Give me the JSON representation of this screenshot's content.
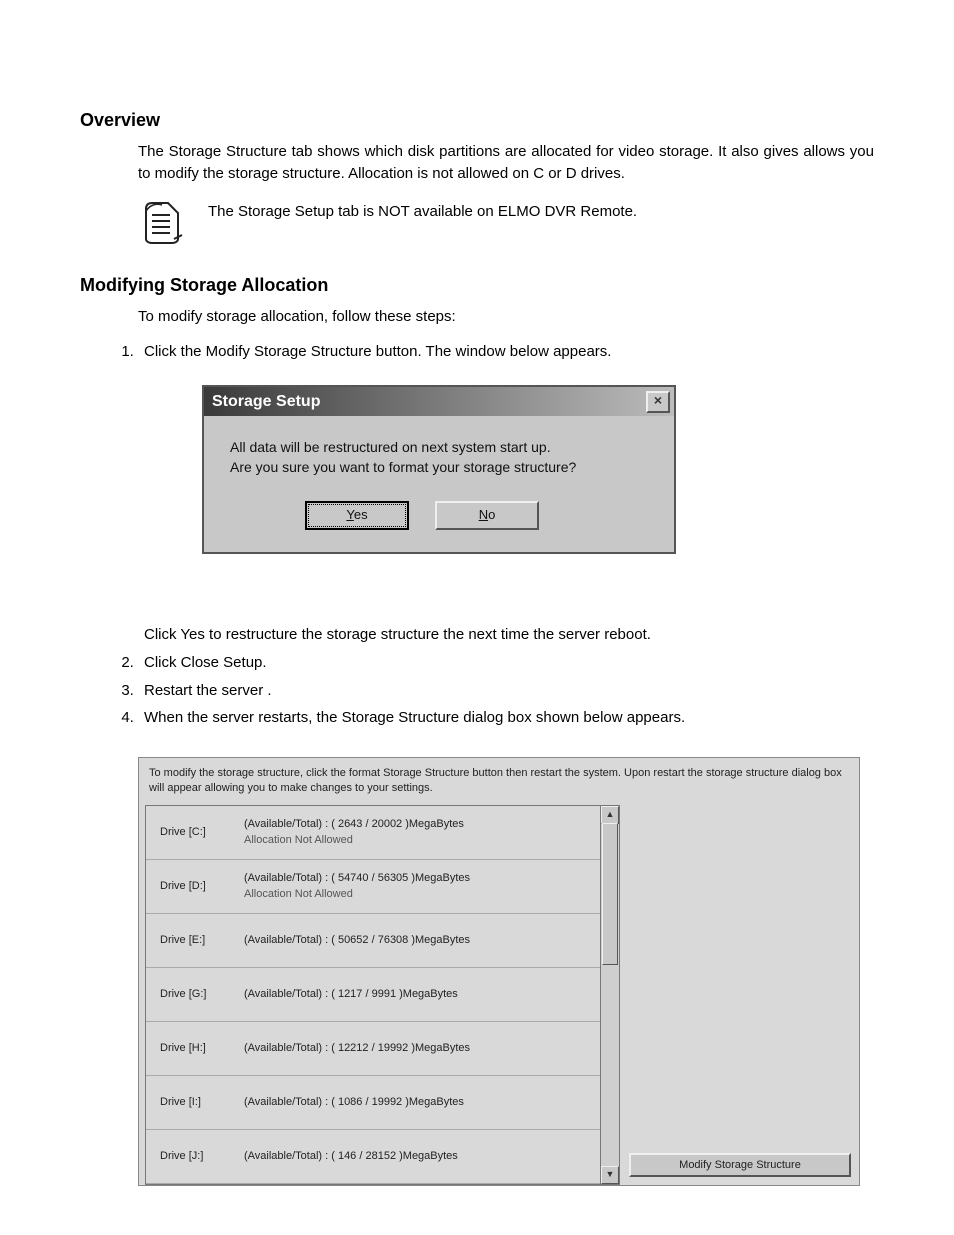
{
  "overview": {
    "heading": "Overview",
    "paragraph": "The Storage Structure tab shows which disk partitions are allocated for video storage. It also gives allows you to modify the storage structure. Allocation is not allowed on C or D drives.",
    "note": "The Storage Setup tab is NOT available on ELMO DVR Remote."
  },
  "modify": {
    "heading": "Modifying Storage Allocation",
    "intro": "To modify storage allocation, follow these steps:",
    "step1": "Click the Modify Storage Structure button. The window below appears.",
    "step1b": "Click Yes to restructure the storage structure the next time the server reboot.",
    "step2": "Click Close Setup.",
    "step3": "Restart the server .",
    "step4": "When the server restarts, the Storage Structure dialog box shown below appears."
  },
  "dialog": {
    "title": "Storage Setup",
    "line1": "All data will be restructured on next system start up.",
    "line2": "Are you sure you want to format your storage structure?",
    "yes": "Yes",
    "no": "No"
  },
  "panel": {
    "header": "To modify the storage structure, click the format Storage Structure button then restart the system. Upon restart the storage structure dialog box will appear allowing you to make changes to your settings.",
    "modify_button": "Modify Storage Structure",
    "warn": "Allocation Not Allowed",
    "drives": [
      {
        "label": "Drive [C:]",
        "info": "(Available/Total) : ( 2643 / 20002 )MegaBytes",
        "restricted": true
      },
      {
        "label": "Drive [D:]",
        "info": "(Available/Total) : ( 54740 / 56305 )MegaBytes",
        "restricted": true
      },
      {
        "label": "Drive [E:]",
        "info": "(Available/Total) : ( 50652 / 76308 )MegaBytes",
        "restricted": false
      },
      {
        "label": "Drive [G:]",
        "info": "(Available/Total) : ( 1217 / 9991 )MegaBytes",
        "restricted": false
      },
      {
        "label": "Drive [H:]",
        "info": "(Available/Total) : ( 12212 / 19992 )MegaBytes",
        "restricted": false
      },
      {
        "label": "Drive [I:]",
        "info": "(Available/Total) : ( 1086 / 19992 )MegaBytes",
        "restricted": false
      },
      {
        "label": "Drive [J:]",
        "info": "(Available/Total) : ( 146 / 28152 )MegaBytes",
        "restricted": false
      }
    ]
  }
}
